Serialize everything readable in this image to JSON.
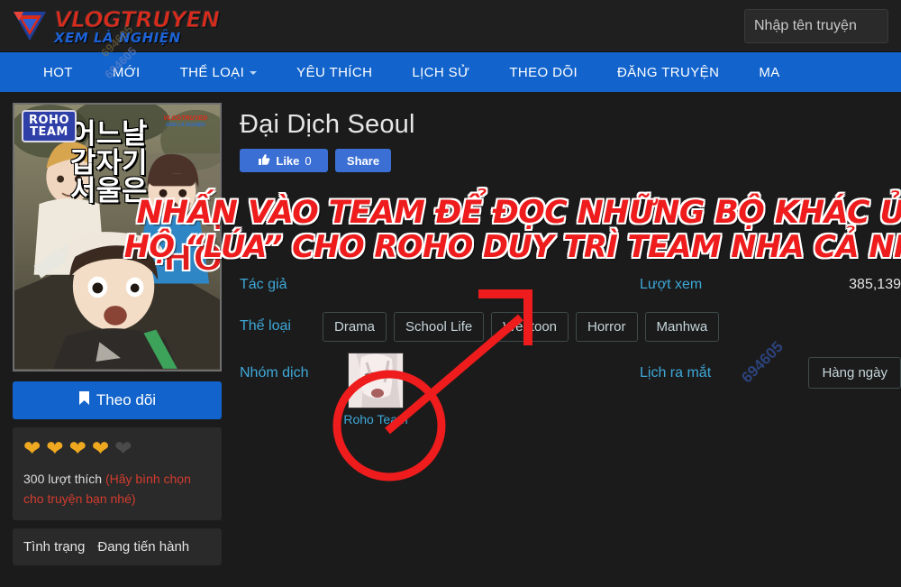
{
  "header": {
    "logo_title": "VLOGTRUYEN",
    "logo_sub": "XEM LÀ NGHIỆN",
    "search_placeholder": "Nhập tên truyện",
    "search_value": ""
  },
  "nav": {
    "items": [
      {
        "label": "HOT",
        "has_caret": false
      },
      {
        "label": "MỚI",
        "has_caret": false
      },
      {
        "label": "THỂ LOẠI",
        "has_caret": true
      },
      {
        "label": "YÊU THÍCH",
        "has_caret": false
      },
      {
        "label": "LỊCH SỬ",
        "has_caret": false
      },
      {
        "label": "THEO DÕI",
        "has_caret": false
      },
      {
        "label": "ĐĂNG TRUYỆN",
        "has_caret": false
      },
      {
        "label": "MA",
        "has_caret": false
      }
    ]
  },
  "cover": {
    "badge_line1": "ROHO",
    "badge_line2": "TEAM",
    "korean_title_line1": "어느날",
    "korean_title_line2": "갑자기",
    "korean_title_line3": "서울은",
    "watermark_a": "VLOGTRUYEN",
    "watermark_b": "XEM LÀ NGHIỆN",
    "art_text_1": "I",
    "art_text_2": "HO"
  },
  "sidebar": {
    "follow_label": "Theo dõi",
    "follow_icon": "bookmark-icon",
    "hearts_filled": 4,
    "hearts_total": 5,
    "like_count_text": "300 lượt thích",
    "like_note": "(Hãy bình chọn cho truyện bạn nhé)",
    "status_label": "Tình trạng",
    "status_value": "Đang tiến hành"
  },
  "main": {
    "title": "Đại Dịch Seoul",
    "like_label": "Like",
    "like_count": "0",
    "share_label": "Share",
    "author_label": "Tác giả",
    "author_value": "",
    "views_label": "Lượt xem",
    "views_value": "385,139",
    "genre_label": "Thể loại",
    "genres": [
      "Drama",
      "School Life",
      "Webtoon",
      "Horror",
      "Manhwa"
    ],
    "team_label": "Nhóm dịch",
    "team_name": "Roho Team",
    "schedule_label": "Lịch ra mắt",
    "schedule_value": "Hàng ngày"
  },
  "overlay": {
    "red_line_1": "NHẤN VÀO TEAM ĐỂ ĐỌC NHỮNG BỘ KHÁC ỦNG",
    "red_line_2": "HỘ “LÚA” CHO ROHO DUY TRÌ TEAM NHA CẢ NHÀ!!",
    "annotation_type": "red-circle-and-arrow"
  },
  "watermarks": {
    "wm_1": "694605",
    "wm_2": "694605",
    "wm_3": "694605"
  },
  "colors": {
    "nav_blue": "#1264cc",
    "accent_blue": "#3ea8d8",
    "page_bg": "#1b1b1b",
    "red_annotation": "#ee1c1c",
    "heart_on": "#efa920",
    "logo_red": "#d92b1c"
  }
}
